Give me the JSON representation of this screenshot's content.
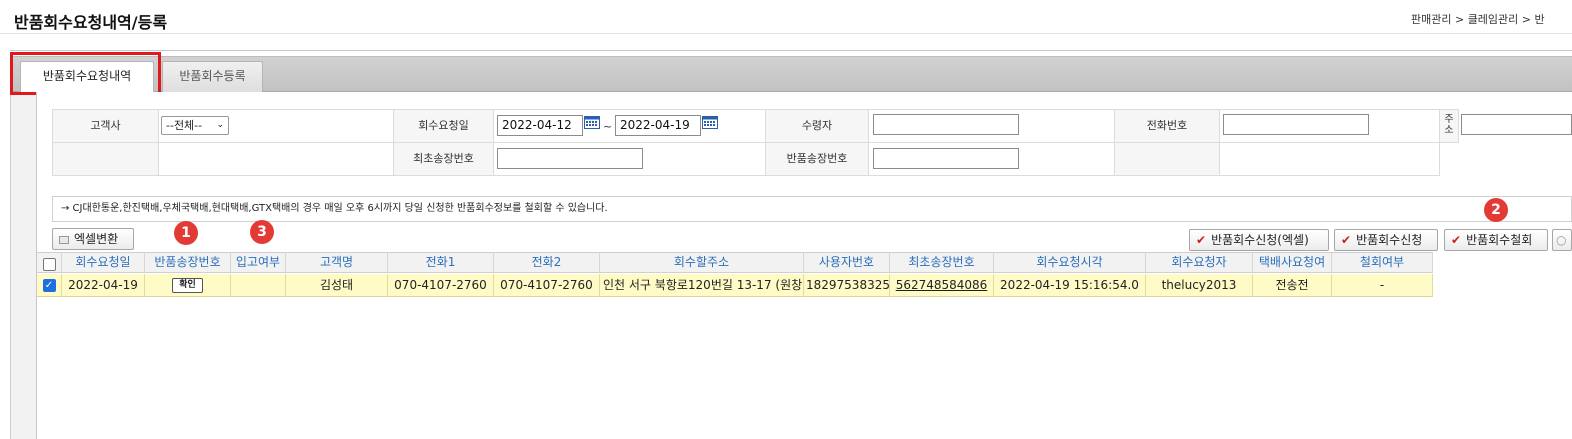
{
  "header": {
    "title": "반품회수요청내역/등록",
    "breadcrumb": "판매관리 > 클레임관리 > 반"
  },
  "tabs": [
    {
      "label": "반품회수요청내역",
      "active": true
    },
    {
      "label": "반품회수등록",
      "active": false
    }
  ],
  "search": {
    "customer_label": "고객사",
    "customer_value": "--전체--",
    "request_date_label": "회수요청일",
    "date_from": "2022-04-12",
    "date_to": "2022-04-19",
    "tilde": "~",
    "receiver_label": "수령자",
    "phone_label": "전화번호",
    "address_label": "주소",
    "first_invoice_label": "최초송장번호",
    "return_invoice_label": "반품송장번호"
  },
  "notice": "→ CJ대한통운,한진택배,우체국택배,현대택배,GTX택배의 경우 매일 오후 6시까지 당일 신청한 반품회수정보를 철회할 수 있습니다.",
  "buttons": {
    "excel": "엑셀변환",
    "request_excel": "반품회수신청(엑셀)",
    "request": "반품회수신청",
    "withdraw": "반품회수철회"
  },
  "badges": [
    "1",
    "2",
    "3"
  ],
  "table": {
    "columns": [
      "회수요청일",
      "반품송장번호",
      "입고여부",
      "고객명",
      "전화1",
      "전화2",
      "회수할주소",
      "사용자번호",
      "최초송장번호",
      "회수요청시각",
      "회수요청자",
      "택배사요청여",
      "철회여부"
    ],
    "rows": [
      {
        "checked": true,
        "request_date": "2022-04-19",
        "return_invoice_button": "확인",
        "received": "",
        "customer_name": "김성태",
        "phone1": "070-4107-2760",
        "phone2": "070-4107-2760",
        "address": "인천 서구 북항로120번길 13-17 (원창",
        "user_no": "182975383253",
        "first_invoice": "562748584086",
        "request_time": "2022-04-19 15:16:54.0",
        "requester": "thelucy2013",
        "courier_request": "전송전",
        "withdrawn": "-"
      }
    ]
  },
  "colors": {
    "accent_blue": "#2a6fbb",
    "row_highlight": "#fffbc7",
    "badge_red": "#e23b36",
    "annotation_red": "#e0191f"
  }
}
